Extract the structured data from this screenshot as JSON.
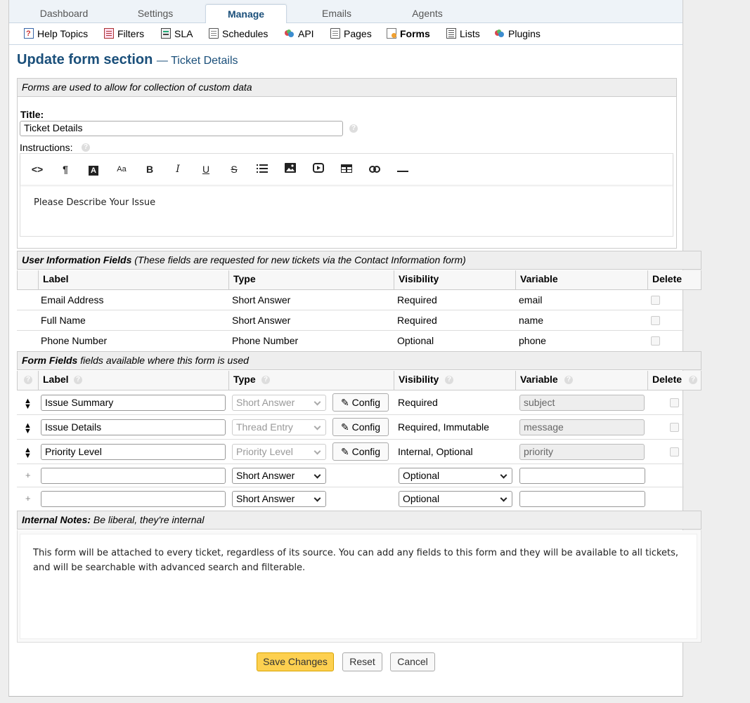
{
  "top_tabs": [
    "Dashboard",
    "Settings",
    "Manage",
    "Emails",
    "Agents"
  ],
  "sub_nav": [
    {
      "label": "Help Topics",
      "icon": "help-topics-icon"
    },
    {
      "label": "Filters",
      "icon": "filters-icon"
    },
    {
      "label": "SLA",
      "icon": "sla-icon"
    },
    {
      "label": "Schedules",
      "icon": "schedules-icon"
    },
    {
      "label": "API",
      "icon": "api-icon"
    },
    {
      "label": "Pages",
      "icon": "pages-icon"
    },
    {
      "label": "Forms",
      "icon": "forms-icon"
    },
    {
      "label": "Lists",
      "icon": "lists-icon"
    },
    {
      "label": "Plugins",
      "icon": "plugins-icon"
    }
  ],
  "heading": {
    "title": "Update form section",
    "subtitle": "— Ticket Details"
  },
  "form_intro": "Forms are used to allow for collection of custom data",
  "title_field": {
    "label": "Title:",
    "value": "Ticket Details"
  },
  "instructions": {
    "label": "Instructions:",
    "content": "Please Describe Your Issue"
  },
  "toolbar": [
    "<>",
    "¶",
    "A",
    "Aa",
    "B",
    "I",
    "U",
    "S",
    "list",
    "image",
    "video",
    "table",
    "link",
    "—"
  ],
  "user_info": {
    "title": "User Information Fields",
    "note": "(These fields are requested for new tickets via the Contact Information form)",
    "columns": [
      "Label",
      "Type",
      "Visibility",
      "Variable",
      "Delete"
    ],
    "rows": [
      {
        "label": "Email Address",
        "type": "Short Answer",
        "visibility": "Required",
        "variable": "email"
      },
      {
        "label": "Full Name",
        "type": "Short Answer",
        "visibility": "Required",
        "variable": "name"
      },
      {
        "label": "Phone Number",
        "type": "Phone Number",
        "visibility": "Optional",
        "variable": "phone"
      }
    ]
  },
  "form_fields": {
    "title": "Form Fields",
    "note": "fields available where this form is used",
    "columns": [
      "Label",
      "Type",
      "Visibility",
      "Variable",
      "Delete"
    ],
    "config_label": "Config",
    "rows": [
      {
        "label": "Issue Summary",
        "type": "Short Answer",
        "visibility": "Required",
        "variable": "subject"
      },
      {
        "label": "Issue Details",
        "type": "Thread Entry",
        "visibility": "Required, Immutable",
        "variable": "message"
      },
      {
        "label": "Priority Level",
        "type": "Priority Level",
        "visibility": "Internal, Optional",
        "variable": "priority"
      }
    ],
    "new_rows": [
      {
        "type": "Short Answer",
        "visibility": "Optional"
      },
      {
        "type": "Short Answer",
        "visibility": "Optional"
      }
    ]
  },
  "internal_notes": {
    "title": "Internal Notes:",
    "note": "Be liberal, they're internal",
    "content": "This form will be attached to every ticket, regardless of its source. You can add any fields to this form and they will be available to all tickets, and will be searchable with advanced search and filterable."
  },
  "actions": {
    "save": "Save Changes",
    "reset": "Reset",
    "cancel": "Cancel"
  },
  "colors": {
    "accent": "#1a4f7a",
    "primary_button": "#fdd050"
  }
}
